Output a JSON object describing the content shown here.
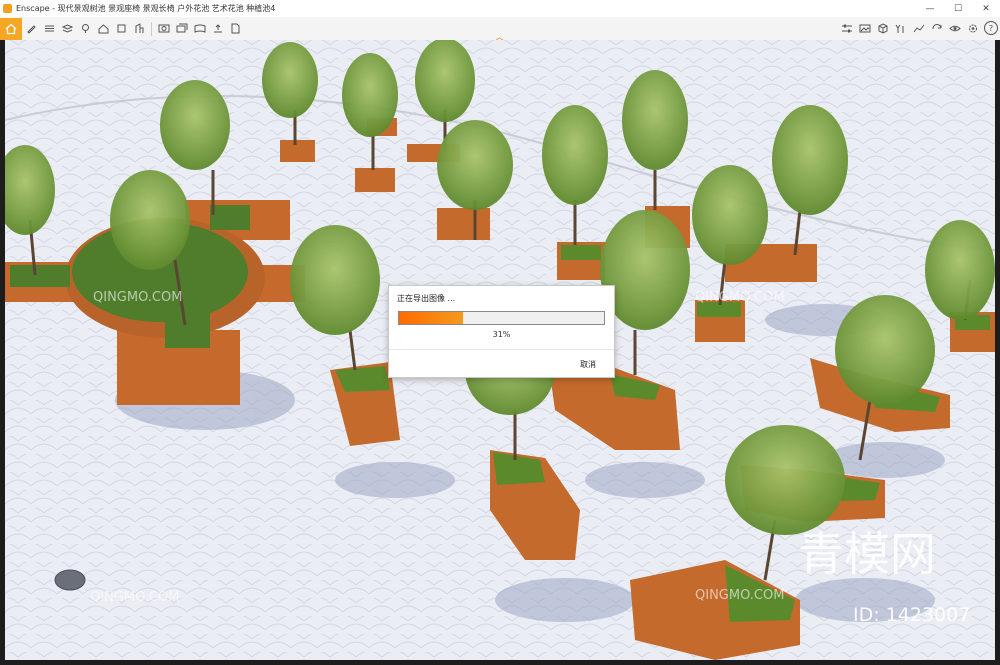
{
  "window": {
    "title": "Enscape - 现代景观树池 景观座椅 景观长椅 户外花池 艺术花池 种植池4",
    "controls": [
      "—",
      "☐",
      "✕"
    ]
  },
  "toolbar": {
    "home_icon": "home-icon",
    "left_icons": [
      "pencil-icon",
      "list-icon",
      "layers-icon",
      "map-pin-icon",
      "house-icon",
      "box-icon",
      "building-icon",
      "screenshot-icon",
      "batch-render-icon",
      "panorama-icon",
      "export-icon",
      "export-file-icon"
    ],
    "right_icons": [
      "settings-sliders-icon",
      "image-icon",
      "cube-icon",
      "asset-icon",
      "chart-icon",
      "sync-icon",
      "visibility-icon",
      "gear-icon",
      "help-icon"
    ],
    "help_label": "?"
  },
  "dialog": {
    "title": "正在导出图像 ...",
    "progress_percent": 31,
    "progress_label": "31%",
    "cancel_label": "取消"
  },
  "watermarks": {
    "site": "QINGMO.COM",
    "brand": "青模网",
    "id_label": "ID: 1423007"
  },
  "colors": {
    "accent": "#f5a623",
    "progress_start": "#ff6a00",
    "progress_end": "#f59a1e"
  }
}
